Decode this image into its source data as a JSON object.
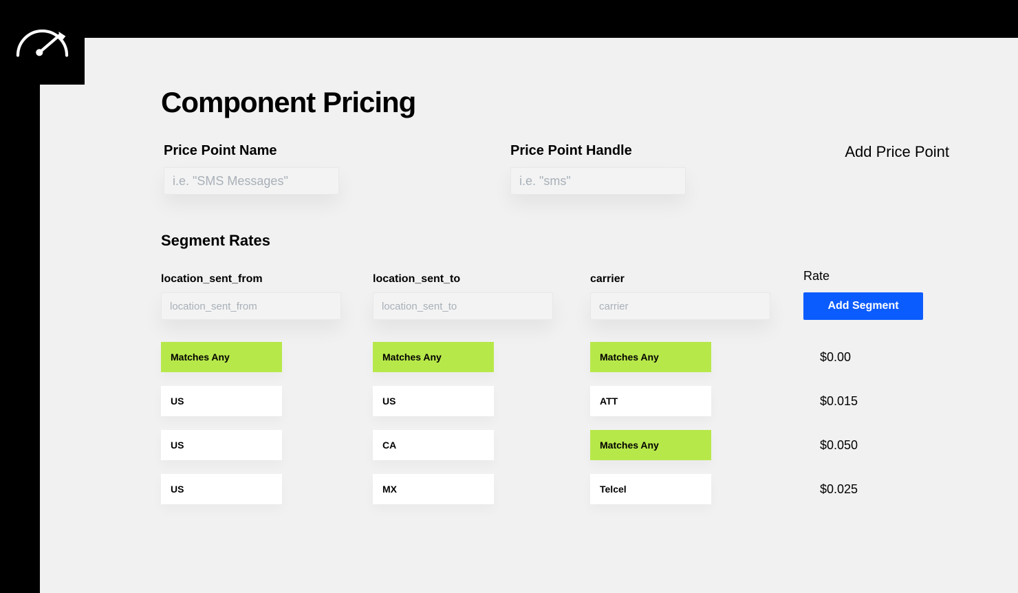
{
  "page_title": "Component Pricing",
  "add_price_point_link": "Add Price Point",
  "fields": {
    "name_label": "Price Point Name",
    "name_placeholder": "i.e. \"SMS Messages\"",
    "handle_label": "Price Point Handle",
    "handle_placeholder": "i.e. \"sms\""
  },
  "segment_rates_title": "Segment Rates",
  "columns": {
    "c1_label": "location_sent_from",
    "c1_placeholder": "location_sent_from",
    "c2_label": "location_sent_to",
    "c2_placeholder": "location_sent_to",
    "c3_label": "carrier",
    "c3_placeholder": "carrier",
    "rate_label": "Rate",
    "add_segment_label": "Add Segment"
  },
  "matches_any_label": "Matches Any",
  "rows": [
    {
      "from": "Matches Any",
      "from_any": true,
      "to": "Matches Any",
      "to_any": true,
      "carrier": "Matches Any",
      "carrier_any": true,
      "rate": "$0.00"
    },
    {
      "from": "US",
      "from_any": false,
      "to": "US",
      "to_any": false,
      "carrier": "ATT",
      "carrier_any": false,
      "rate": "$0.015"
    },
    {
      "from": "US",
      "from_any": false,
      "to": "CA",
      "to_any": false,
      "carrier": "Matches Any",
      "carrier_any": true,
      "rate": "$0.050"
    },
    {
      "from": "US",
      "from_any": false,
      "to": "MX",
      "to_any": false,
      "carrier": "Telcel",
      "carrier_any": false,
      "rate": "$0.025"
    }
  ]
}
